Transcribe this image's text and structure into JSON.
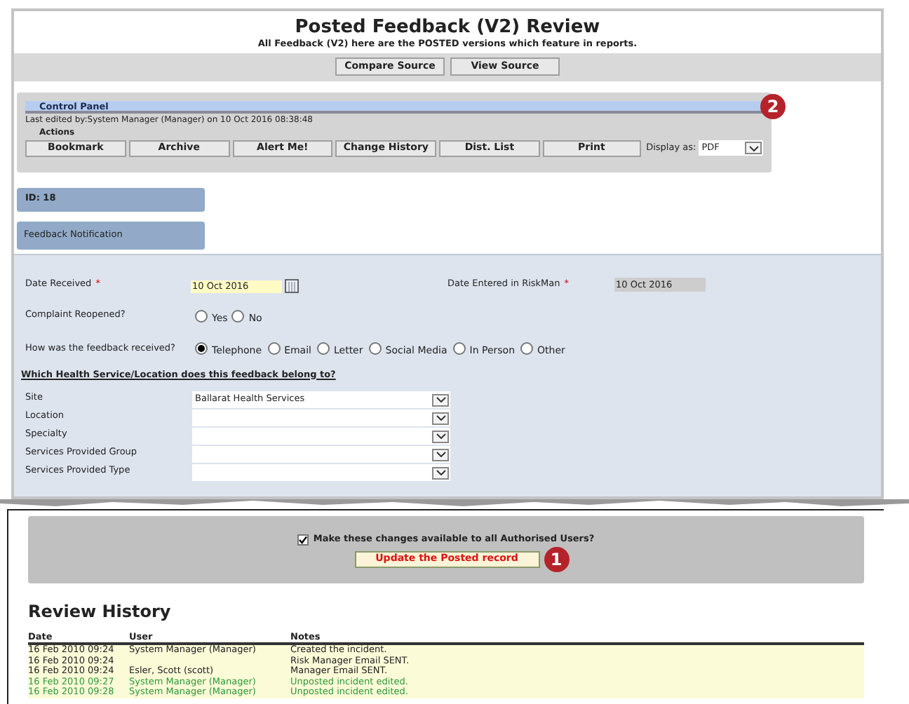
{
  "header": {
    "title": "Posted Feedback (V2) Review",
    "subtitle": "All Feedback (V2) here are the POSTED versions which feature in reports.",
    "buttons": [
      "Compare Source",
      "View Source"
    ]
  },
  "control_panel": {
    "title": "Control Panel",
    "callout": "2",
    "last_edited": "Last edited by:System Manager (Manager) on 10 Oct 2016 08:38:48",
    "actions_label": "Actions",
    "buttons": [
      "Bookmark",
      "Archive",
      "Alert Me!",
      "Change History",
      "Dist. List",
      "Print"
    ],
    "display_label": "Display as:",
    "display_value": "PDF"
  },
  "id_box": "ID: 18",
  "section_title": "Feedback Notification",
  "form": {
    "date_received": {
      "label": "Date Received",
      "required_mark": "*",
      "value": "10 Oct 2016"
    },
    "date_entered": {
      "label": "Date Entered in RiskMan",
      "required_mark": "*",
      "value": "10 Oct 2016"
    },
    "reopened": {
      "label": "Complaint Reopened?",
      "options": [
        {
          "label": "Yes",
          "selected": false
        },
        {
          "label": "No",
          "selected": false
        }
      ]
    },
    "received_via": {
      "label": "How was the feedback received?",
      "options": [
        {
          "label": "Telephone",
          "selected": true
        },
        {
          "label": "Email",
          "selected": false
        },
        {
          "label": "Letter",
          "selected": false
        },
        {
          "label": "Social Media",
          "selected": false
        },
        {
          "label": "In Person",
          "selected": false
        },
        {
          "label": "Other",
          "selected": false
        }
      ]
    },
    "location_heading": "Which Health Service/Location does this feedback belong to?",
    "selects": [
      {
        "label": "Site",
        "value": "Ballarat Health Services"
      },
      {
        "label": "Location"
      },
      {
        "label": "Specialty"
      },
      {
        "label": "Services Provided Group"
      },
      {
        "label": "Services Provided Type"
      }
    ]
  },
  "update": {
    "checkbox": {
      "label": "Make these changes available to all Authorised Users?",
      "checked": true
    },
    "button": "Update the Posted record",
    "callout": "1"
  },
  "review_history": {
    "title": "Review History",
    "columns": [
      "Date",
      "User",
      "Notes"
    ],
    "rows": [
      {
        "date": "16 Feb 2010 09:24",
        "user": "System Manager (Manager)",
        "notes": "Created the incident.",
        "color": "#222222"
      },
      {
        "date": "16 Feb 2010 09:24",
        "notes": "Risk Manager Email SENT.",
        "color": "#222222"
      },
      {
        "date": "16 Feb 2010 09:24",
        "user": "Esler, Scott (scott)",
        "notes": "Manager Email SENT.",
        "color": "#222222"
      },
      {
        "date": "16 Feb 2010 09:27",
        "user": "System Manager (Manager)",
        "notes": "Unposted incident edited.",
        "color": "#2e9a3a"
      },
      {
        "date": "16 Feb 2010 09:28",
        "user": "System Manager (Manager)",
        "notes": "Unposted incident edited.",
        "color": "#2e9a3a"
      }
    ]
  }
}
